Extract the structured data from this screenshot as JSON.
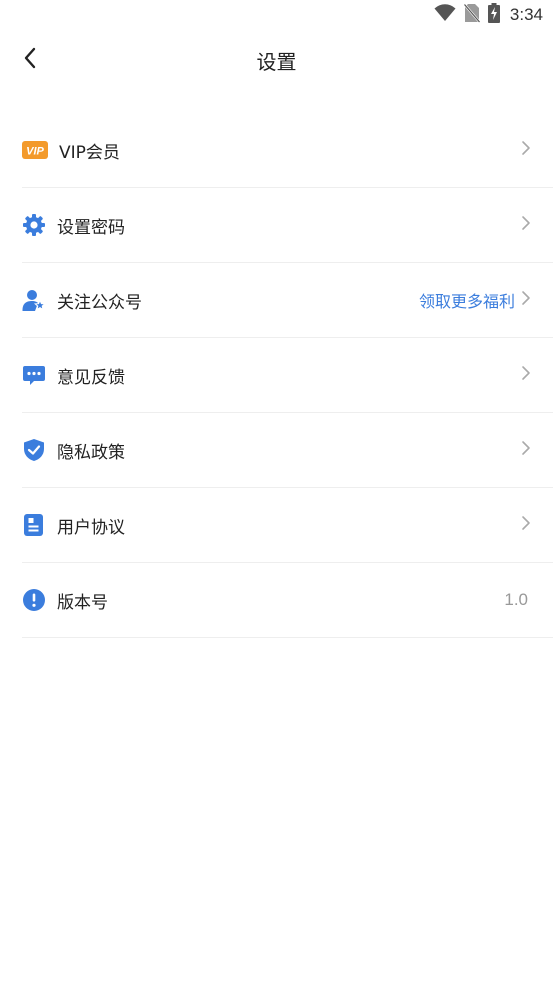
{
  "status_bar": {
    "time": "3:34",
    "icons": [
      "wifi-icon",
      "no-sim-icon",
      "battery-charging-icon"
    ]
  },
  "header": {
    "title": "设置",
    "back_icon": "chevron-left-icon"
  },
  "settings": [
    {
      "label": "VIP会员",
      "icon": "vip-badge-icon",
      "icon_text": "VIP",
      "color": "#f39a2b"
    },
    {
      "label": "设置密码",
      "icon": "gear-icon",
      "color": "#3b7ddd"
    },
    {
      "label": "关注公众号",
      "icon": "user-star-icon",
      "color": "#3b7ddd",
      "extra": "领取更多福利"
    },
    {
      "label": "意见反馈",
      "icon": "chat-dots-icon",
      "color": "#3b7ddd"
    },
    {
      "label": "隐私政策",
      "icon": "shield-check-icon",
      "color": "#3b7ddd"
    },
    {
      "label": "用户协议",
      "icon": "document-icon",
      "color": "#3b7ddd"
    },
    {
      "label": "版本号",
      "icon": "info-exclamation-icon",
      "color": "#3b7ddd",
      "value": "1.0"
    }
  ],
  "colors": {
    "accent": "#3b7ddd",
    "vip": "#f39a2b",
    "divider": "#eeeeee",
    "chevron": "#aaaaaa",
    "muted_text": "#999999"
  }
}
